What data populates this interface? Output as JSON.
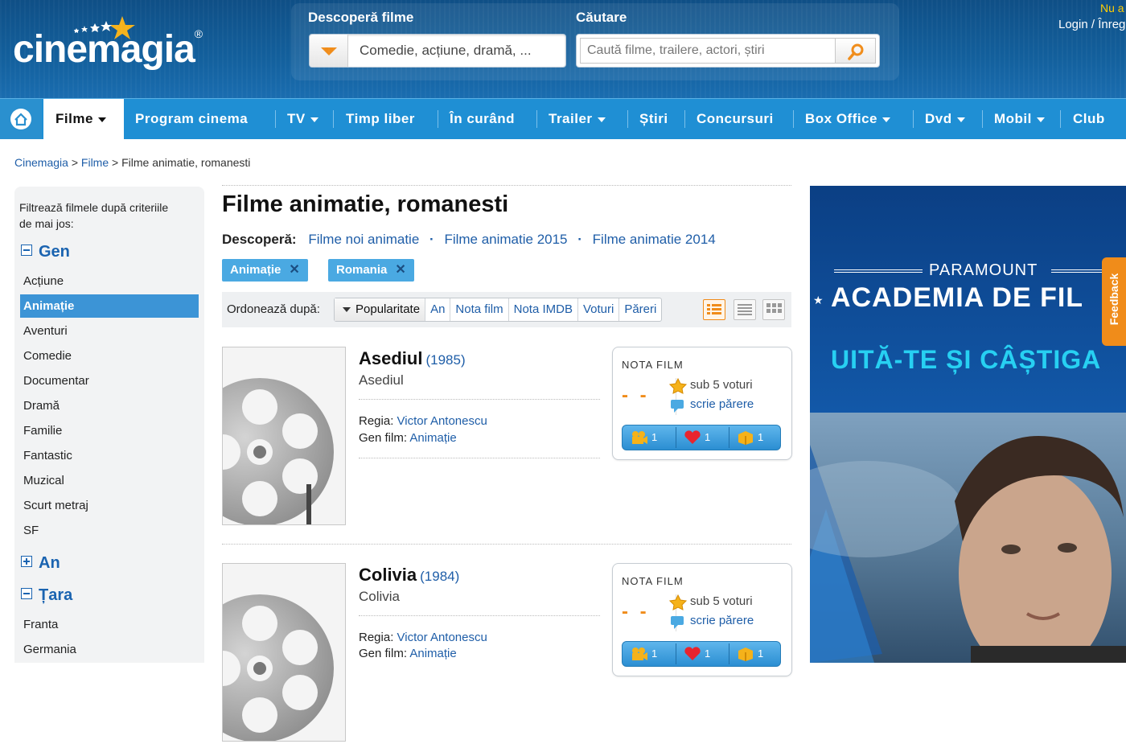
{
  "header": {
    "logo": "cinemagia",
    "discover_label": "Descoperă filme",
    "discover_value": "Comedie, acțiune, dramă, ...",
    "search_label": "Căutare",
    "search_placeholder": "Caută filme, trailere, actori, știri",
    "nua": "Nu a",
    "login": "Login / Înreg"
  },
  "nav": {
    "items": [
      {
        "label": "Filme",
        "dropdown": true
      },
      {
        "label": "Program cinema",
        "dropdown": false
      },
      {
        "label": "TV",
        "dropdown": true
      },
      {
        "label": "Timp liber",
        "dropdown": false
      },
      {
        "label": "În curând",
        "dropdown": false
      },
      {
        "label": "Trailer",
        "dropdown": true
      },
      {
        "label": "Știri",
        "dropdown": false
      },
      {
        "label": "Concursuri",
        "dropdown": false
      },
      {
        "label": "Box Office",
        "dropdown": true
      },
      {
        "label": "Dvd",
        "dropdown": true
      },
      {
        "label": "Mobil",
        "dropdown": true
      },
      {
        "label": "Club",
        "dropdown": false
      }
    ]
  },
  "breadcrumb": {
    "home": "Cinemagia",
    "sep": ">",
    "filme": "Filme",
    "current": "Filme animatie, romanesti"
  },
  "sidebar": {
    "intro": "Filtrează filmele după criteriile de mai jos:",
    "gen_title": "Gen",
    "gen_items": [
      "Acțiune",
      "Animație",
      "Aventuri",
      "Comedie",
      "Documentar",
      "Dramă",
      "Familie",
      "Fantastic",
      "Muzical",
      "Scurt metraj",
      "SF"
    ],
    "an_title": "An",
    "tara_title": "Țara",
    "tara_items": [
      "Franta",
      "Germania"
    ]
  },
  "main": {
    "title": "Filme animatie, romanesti",
    "discover_label": "Descoperă:",
    "discover_links": [
      "Filme noi animatie",
      "Filme animatie 2015",
      "Filme animatie 2014"
    ],
    "tags": [
      "Animație",
      "Romania"
    ],
    "sort_label": "Ordonează după:",
    "sort_options": [
      "Popularitate",
      "An",
      "Nota film",
      "Nota IMDB",
      "Voturi",
      "Păreri"
    ]
  },
  "films": [
    {
      "title": "Asediul",
      "year": "(1985)",
      "original": "Asediul",
      "director_label": "Regia:",
      "director": "Victor Antonescu",
      "genre_label": "Gen film:",
      "genre": "Animație",
      "rating_title": "NOTA FILM",
      "score": "- -",
      "votes": "sub 5 voturi",
      "review": "scrie părere",
      "counts": [
        "1",
        "1",
        "1"
      ]
    },
    {
      "title": "Colivia",
      "year": "(1984)",
      "original": "Colivia",
      "director_label": "Regia:",
      "director": "Victor Antonescu",
      "genre_label": "Gen film:",
      "genre": "Animație",
      "rating_title": "NOTA FILM",
      "score": "- -",
      "votes": "sub 5 voturi",
      "review": "scrie părere",
      "counts": [
        "1",
        "1",
        "1"
      ]
    }
  ],
  "ad": {
    "brand": "PARAMOUNT",
    "headline": "ACADEMIA DE FIL",
    "sub": "UITĂ-TE ȘI CÂȘTIGA"
  },
  "feedback": "Feedback",
  "colors": {
    "accent": "#1f8fd4",
    "orange": "#f08c1a",
    "link": "#1f5ea8"
  }
}
